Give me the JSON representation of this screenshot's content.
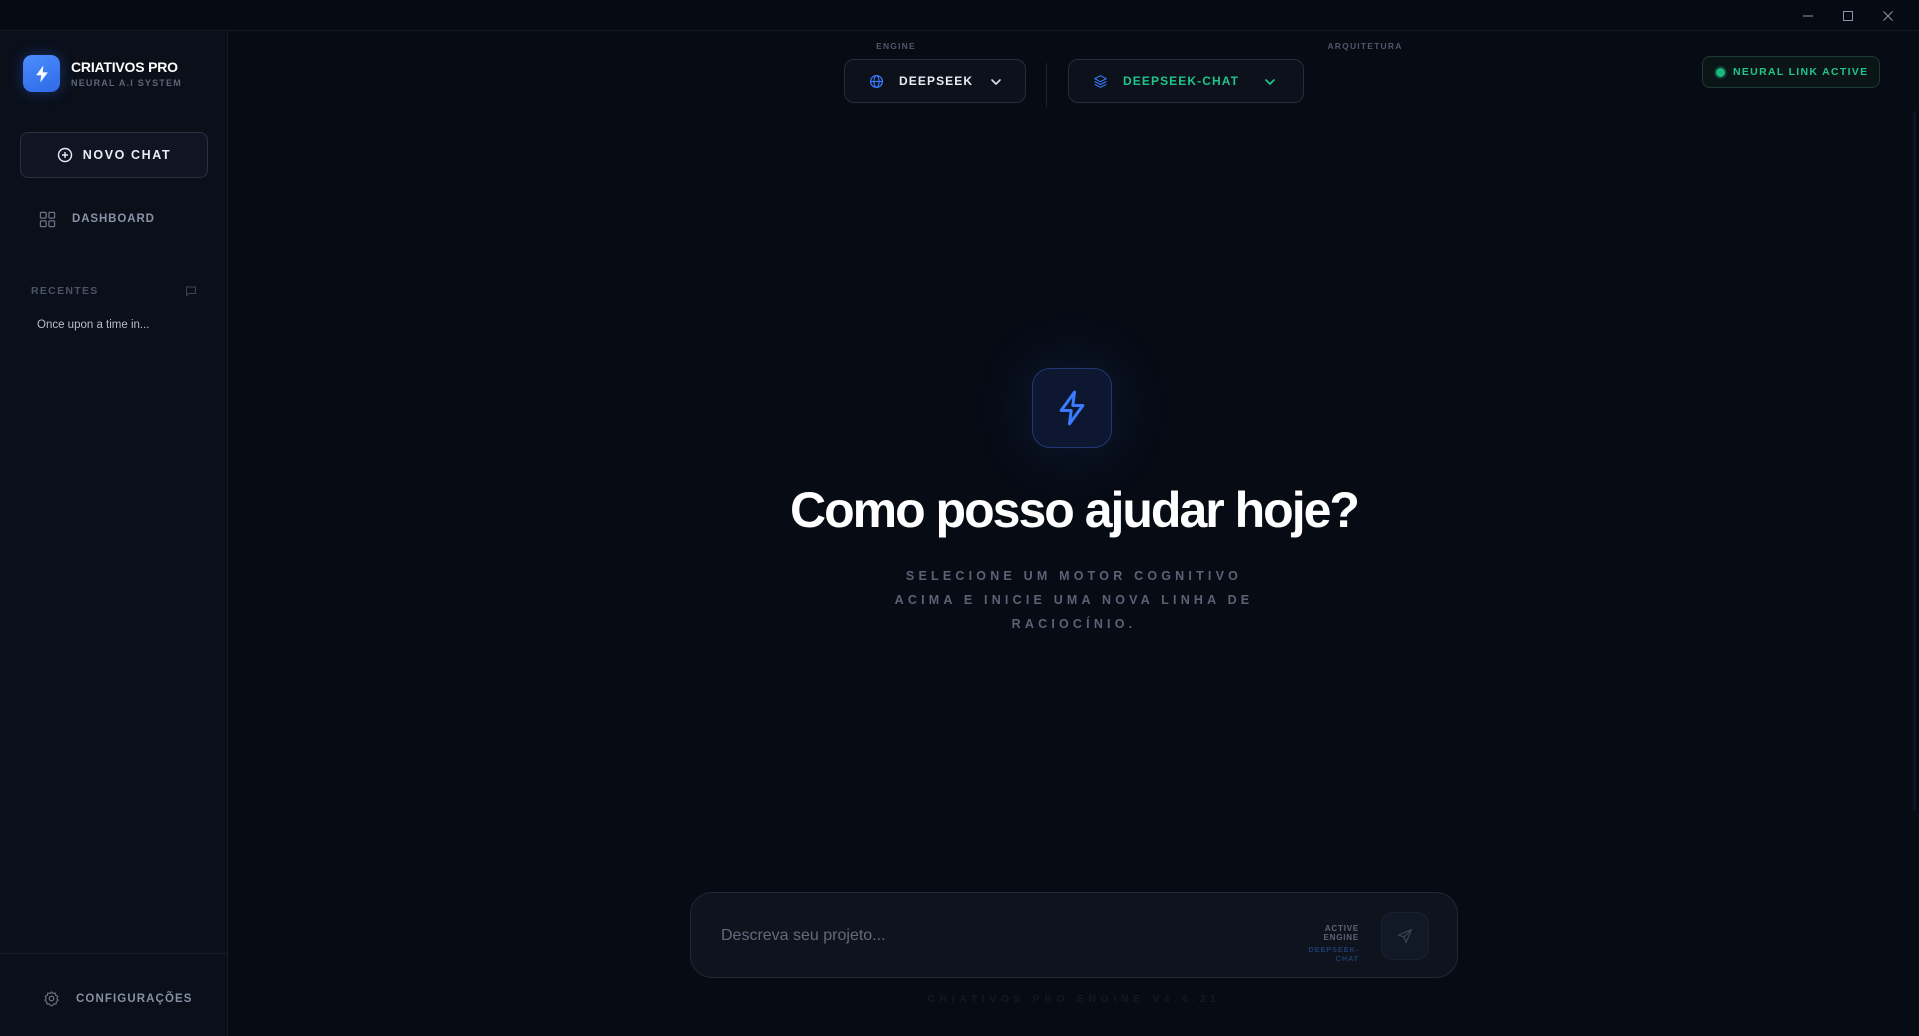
{
  "window": {
    "controls": [
      "minimize",
      "maximize",
      "close"
    ]
  },
  "sidebar": {
    "brand_name": "CRIATIVOS PRO",
    "brand_subtitle": "NEURAL A.I SYSTEM",
    "new_chat_label": "NOVO CHAT",
    "dashboard_label": "DASHBOARD",
    "recent_heading": "RECENTES",
    "recent_items": [
      {
        "label": "Once upon a time in..."
      }
    ],
    "settings_label": "CONFIGURAÇÕES"
  },
  "header": {
    "engine_label": "ENGINE",
    "engine_value": "DEEPSEEK",
    "architecture_label": "ARQUITETURA",
    "architecture_value": "DEEPSEEK-CHAT",
    "status_label": "NEURAL LINK ACTIVE"
  },
  "hero": {
    "title": "Como posso ajudar hoje?",
    "subtitle": "SELECIONE UM MOTOR COGNITIVO ACIMA E INICIE UMA NOVA LINHA DE RACIOCÍNIO."
  },
  "composer": {
    "placeholder": "Descreva seu projeto...",
    "value": "",
    "active_engine_label": "ACTIVE ENGINE",
    "active_engine_value": "DEEPSEEK-CHAT"
  },
  "footer": {
    "version": "CRIATIVOS PRO ENGINE V4.4.21"
  },
  "colors": {
    "background": "#070b14",
    "sidebar": "#0a0f1a",
    "accent_blue": "#3b7bff",
    "accent_green": "#20c58a"
  },
  "icons": {
    "brand": "bolt-icon",
    "new_chat": "plus-circle-icon",
    "dashboard": "grid-icon",
    "recent": "chat-bubble-icon",
    "settings": "gear-icon",
    "engine": "globe-icon",
    "architecture": "layers-icon",
    "dropdown": "chevron-down-icon",
    "hero": "bolt-icon",
    "send": "send-icon"
  }
}
